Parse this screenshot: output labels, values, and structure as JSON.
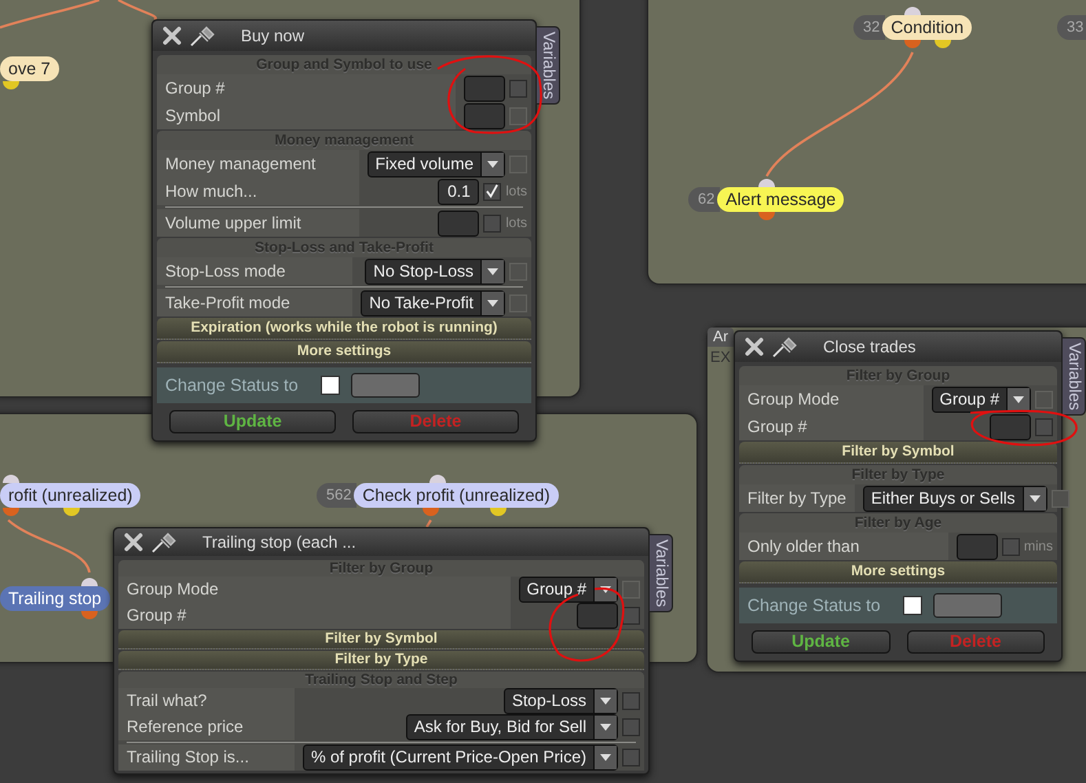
{
  "background_panel": {
    "tab": "Ar",
    "text": "EX"
  },
  "nodes": [
    {
      "label": "ove 7",
      "color": "#f6e3b6"
    },
    {
      "number": "32",
      "label": "Condition",
      "color": "#f6e3b6"
    },
    {
      "number": "33"
    },
    {
      "number": "62",
      "label": "Alert message",
      "color": "#f7f553"
    },
    {
      "label": "rofit (unrealized)",
      "color": "#c9cdf6"
    },
    {
      "number": "562",
      "label": "Check profit (unrealized)",
      "color": "#c9cdf6"
    },
    {
      "label": "Trailing stop",
      "color": "#5b74b4"
    }
  ],
  "dialogs": [
    {
      "title": "Buy now",
      "side_tab": "Variables",
      "sections": [
        {
          "kind": "group",
          "title": "Group and Symbol to use",
          "rows": [
            {
              "label": "Group #",
              "control": {
                "kind": "input",
                "checked": false,
                "disabled": false
              }
            },
            {
              "label": "Symbol",
              "control": {
                "kind": "input",
                "checked": false,
                "disabled": true
              }
            }
          ]
        },
        {
          "kind": "group",
          "title": "Money management",
          "rows": [
            {
              "label": "Money management",
              "control": {
                "kind": "select",
                "value": "Fixed volume",
                "checked": false,
                "disabled": true
              }
            },
            {
              "label": "How much...",
              "control": {
                "kind": "input",
                "value": "0.1",
                "unit": "lots",
                "checked": true,
                "disabled": false
              }
            },
            {
              "label": "Volume upper limit",
              "separated": true,
              "control": {
                "kind": "input",
                "unit": "lots",
                "checked": false,
                "disabled": false
              }
            }
          ]
        },
        {
          "kind": "group",
          "title": "Stop-Loss and Take-Profit",
          "rows": [
            {
              "label": "Stop-Loss mode",
              "control": {
                "kind": "select",
                "value": "No Stop-Loss",
                "checked": false,
                "disabled": true
              }
            },
            {
              "label": "Take-Profit mode",
              "separated": true,
              "control": {
                "kind": "select",
                "value": "No Take-Profit",
                "checked": false,
                "disabled": true
              }
            }
          ]
        },
        {
          "kind": "bar",
          "title": "Expiration (works while the robot is running)"
        },
        {
          "kind": "bar",
          "title": "More settings"
        },
        {
          "kind": "status",
          "title": "Change Status to",
          "checked": false
        }
      ],
      "buttons": [
        {
          "label": "Update",
          "kind": "update"
        },
        {
          "label": "Delete",
          "kind": "delete"
        }
      ]
    },
    {
      "title": "Close trades",
      "side_tab": "Variables",
      "sections": [
        {
          "kind": "group",
          "title": "Filter by Group",
          "rows": [
            {
              "label": "Group Mode",
              "control": {
                "kind": "select",
                "value": "Group #",
                "checked": false,
                "disabled": true
              }
            },
            {
              "label": "Group #",
              "control": {
                "kind": "input",
                "checked": false,
                "disabled": false
              }
            }
          ]
        },
        {
          "kind": "bar",
          "title": "Filter by Symbol"
        },
        {
          "kind": "group",
          "title": "Filter by Type",
          "rows": [
            {
              "label": "Filter by Type",
              "control": {
                "kind": "select",
                "value": "Either Buys or Sells",
                "checked": false,
                "disabled": true
              }
            }
          ]
        },
        {
          "kind": "group",
          "title": "Filter by Age",
          "rows": [
            {
              "label": "Only older than",
              "control": {
                "kind": "input",
                "unit": "mins",
                "checked": false,
                "disabled": false
              }
            }
          ]
        },
        {
          "kind": "bar",
          "title": "More settings"
        },
        {
          "kind": "status",
          "title": "Change Status to",
          "checked": false
        }
      ],
      "buttons": [
        {
          "label": "Update",
          "kind": "update"
        },
        {
          "label": "Delete",
          "kind": "delete"
        }
      ]
    },
    {
      "title": "Trailing stop (each ...",
      "side_tab": "Variables",
      "sections": [
        {
          "kind": "group",
          "title": "Filter by Group",
          "rows": [
            {
              "label": "Group Mode",
              "control": {
                "kind": "select",
                "value": "Group #",
                "checked": false,
                "disabled": true
              }
            },
            {
              "label": "Group #",
              "control": {
                "kind": "input",
                "checked": false,
                "disabled": false
              }
            }
          ]
        },
        {
          "kind": "bar",
          "title": "Filter by Symbol"
        },
        {
          "kind": "bar",
          "title": "Filter by Type"
        },
        {
          "kind": "group",
          "title": "Trailing Stop and Step",
          "rows": [
            {
              "label": "Trail what?",
              "control": {
                "kind": "select",
                "value": "Stop-Loss",
                "checked": false,
                "disabled": false
              }
            },
            {
              "label": "Reference price",
              "control": {
                "kind": "select",
                "value": "Ask for Buy, Bid for Sell",
                "checked": false,
                "disabled": false
              }
            },
            {
              "label": "Trailing Stop is...",
              "separated": true,
              "control": {
                "kind": "select",
                "value": "% of profit (Current Price-Open Price)",
                "checked": false,
                "disabled": false
              }
            }
          ]
        }
      ]
    }
  ]
}
